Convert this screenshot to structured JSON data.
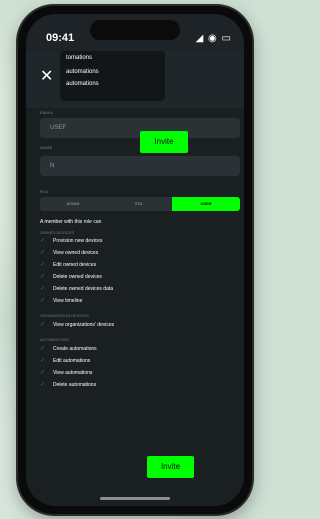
{
  "status": {
    "time": "09:41",
    "icons": "◢ ◉ ▭"
  },
  "header": {
    "close": "✕",
    "dropdown_items": [
      "tomations",
      "automations",
      "automations"
    ]
  },
  "form": {
    "email_label": "EMAIL",
    "email_value": "USEF",
    "name_label": "NAME",
    "name_value": "N",
    "role_label": "ROL",
    "role_options": [
      "ADMIN",
      "STA.",
      "USER"
    ],
    "role_selected": "USER"
  },
  "toast_invite": "Invite",
  "description": "A member with this role can",
  "sections": [
    {
      "title": "OWNED DEVICES",
      "items": [
        "Provision new devices",
        "View owned devices",
        "Edit owned devices",
        "Delete owned devices",
        "Delete owned devices data",
        "View timeline"
      ]
    },
    {
      "title": "ORGANIZATION DEVICES",
      "items": [
        "View organizations' devices"
      ]
    },
    {
      "title": "AUTOMATIONS",
      "items": [
        "Create automations",
        "Edit automations",
        "View automations",
        "Delete automations"
      ]
    }
  ],
  "bottom_button": "Invite",
  "colors": {
    "accent": "#00ff00",
    "background": "#20272a"
  }
}
